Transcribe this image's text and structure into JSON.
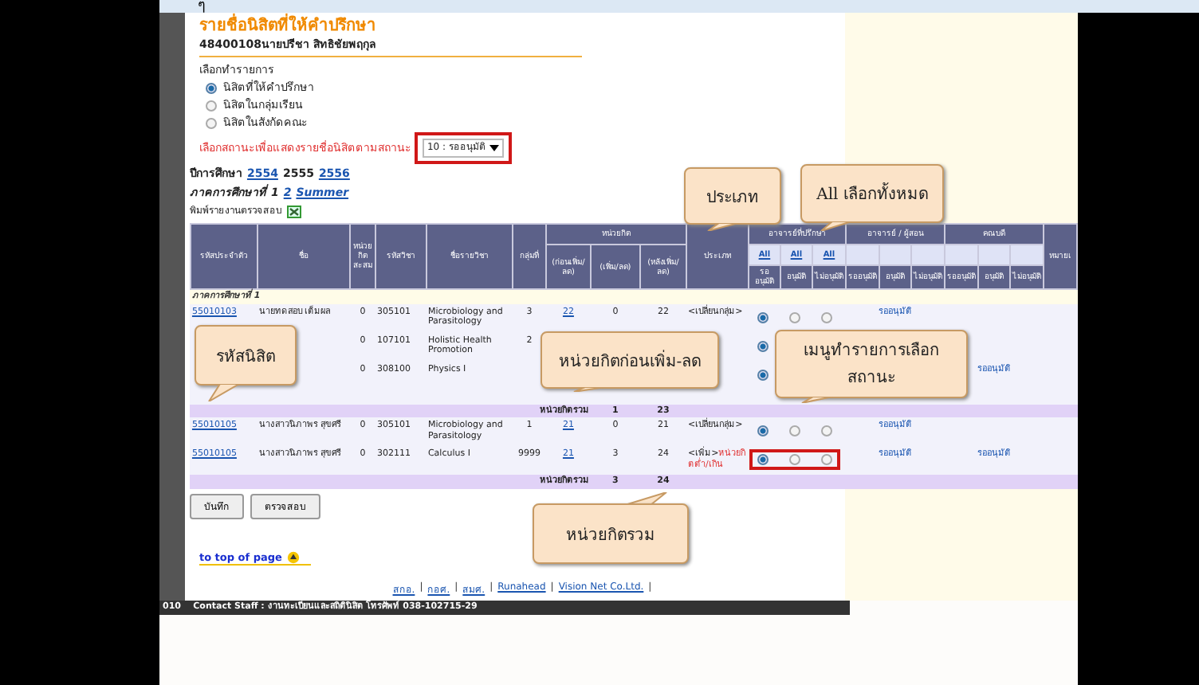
{
  "top_mark": "ๆ",
  "title": "รายชื่อนิสิตที่ให้คำปรึกษา",
  "advisor": "48400108นายปรีชา สิทธิชัยพฤกุล",
  "choose_label": "เลือกทำรายการ",
  "options": [
    {
      "label": "นิสิตที่ให้คำปรึกษา",
      "selected": true
    },
    {
      "label": "นิสิตในกลุ่มเรียน",
      "selected": false
    },
    {
      "label": "นิสิตในสังกัดคณะ",
      "selected": false
    }
  ],
  "status_filter": {
    "label": "เลือกสถานะเพื่อแสดงรายชื่อนิสิตตามสถานะ",
    "value": "10 : รออนุมัติ",
    "highlighted": true
  },
  "years": {
    "label": "ปีการศึกษา",
    "items": [
      {
        "text": "2554",
        "selected": false
      },
      {
        "text": "2555",
        "selected": true
      },
      {
        "text": "2556",
        "selected": false
      }
    ]
  },
  "terms": {
    "label": "ภาคการศึกษาที่",
    "items": [
      {
        "text": "1",
        "selected": true
      },
      {
        "text": "2",
        "selected": false
      },
      {
        "text": "Summer",
        "selected": false
      }
    ]
  },
  "print_report": "พิมพ์รายงานตรวจสอบ",
  "table": {
    "columns_left": [
      "รหัสประจำตัว",
      "ชื่อ",
      "หน่วยกิตสะสม",
      "รหัสวิชา",
      "ชื่อรายวิชา",
      "กลุ่มที่"
    ],
    "credits": {
      "title": "หน่วยกิต",
      "columns": [
        "(ก่อนเพิ่ม/ลด)",
        "(เพิ่ม/ลด)",
        "(หลังเพิ่ม/ลด)"
      ]
    },
    "type_column": "ประเภท",
    "approval_groups": [
      {
        "title": "อาจารย์ที่ปรึกษา",
        "all_links": [
          "All",
          "All",
          "All"
        ],
        "columns": [
          "รออนุมัติ",
          "อนุมัติ",
          "ไม่อนุมัติ"
        ]
      },
      {
        "title": "อาจารย์ / ผู้สอน",
        "columns": [
          "รออนุมัติ",
          "อนุมัติ",
          "ไม่อนุมัติ"
        ]
      },
      {
        "title": "คณบดี",
        "columns": [
          "รออนุมัติ",
          "อนุมัติ",
          "ไม่อนุมัติ"
        ]
      }
    ],
    "note_column": "หมายเ",
    "section": "ภาคการศึกษาที่ 1",
    "rows": [
      {
        "kind": "course",
        "id": "55010103",
        "name": "นายทดสอบ เต็มผล",
        "cumulative": "0",
        "code": "305101",
        "subject": "Microbiology and Parasitology",
        "group": "3",
        "before": "22",
        "change": "0",
        "after": "22",
        "type": "<เปลี่ยนกลุ่ม>",
        "choices": [
          true,
          false,
          false
        ],
        "teacher_status": "รออนุมัติ",
        "highlighted": false
      },
      {
        "kind": "course",
        "cumulative": "0",
        "code": "107101",
        "subject": "Holistic Health Promotion",
        "group": "2",
        "choices": [
          true
        ],
        "highlighted": false
      },
      {
        "kind": "course",
        "cumulative": "0",
        "code": "308100",
        "subject": "Physics I",
        "choices": [
          true
        ],
        "dean_status": "รออนุมัติ",
        "highlighted": false
      },
      {
        "kind": "subtotal",
        "label": "หน่วยกิตรวม",
        "change": "1",
        "after": "23"
      },
      {
        "kind": "course",
        "id": "55010105",
        "name": "นางสาวนิภาพร สุขศรี",
        "cumulative": "0",
        "code": "305101",
        "subject": "Microbiology and Parasitology",
        "group": "1",
        "before": "21",
        "change": "0",
        "after": "21",
        "type": "<เปลี่ยนกลุ่ม>",
        "choices": [
          true,
          false,
          false
        ],
        "teacher_status": "รออนุมัติ",
        "highlighted": false
      },
      {
        "kind": "course",
        "id": "55010105",
        "name": "นางสาวนิภาพร สุขศรี",
        "cumulative": "0",
        "code": "302111",
        "subject": "Calculus I",
        "group": "9999",
        "before": "21",
        "change": "3",
        "after": "24",
        "type": "<เพิ่ม>",
        "type_note": "หน่วยกิตต่ำ/เกิน",
        "choices": [
          true,
          false,
          false
        ],
        "teacher_status": "รออนุมัติ",
        "dean_status": "รออนุมัติ",
        "highlighted": true
      },
      {
        "kind": "subtotal",
        "label": "หน่วยกิตรวม",
        "change": "3",
        "after": "24"
      }
    ]
  },
  "buttons": [
    "บันทึก",
    "ตรวจสอบ"
  ],
  "top_link": "to top of page",
  "footer_links": [
    "สกอ.",
    "กอศ.",
    "สมศ.",
    "Runahead",
    "Vision Net Co.Ltd."
  ],
  "footer_separator": "|",
  "status_bar": "010    Contact Staff : งานทะเบียนและสถิตินิสิต โทรศัพท์ 038-102715-29",
  "callouts": [
    {
      "text": "ประเภท",
      "kind": "down"
    },
    {
      "text": "All เลือกทั้งหมด",
      "kind": "down"
    },
    {
      "text": "รหัสนิสิต",
      "kind": "down"
    },
    {
      "text": "หน่วยกิตก่อนเพิ่ม-ลด",
      "kind": "down"
    },
    {
      "text": "เมนูทำรายการเลือกสถานะ",
      "kind": "down"
    },
    {
      "text": "หน่วยกิตรวม",
      "kind": "up"
    }
  ]
}
